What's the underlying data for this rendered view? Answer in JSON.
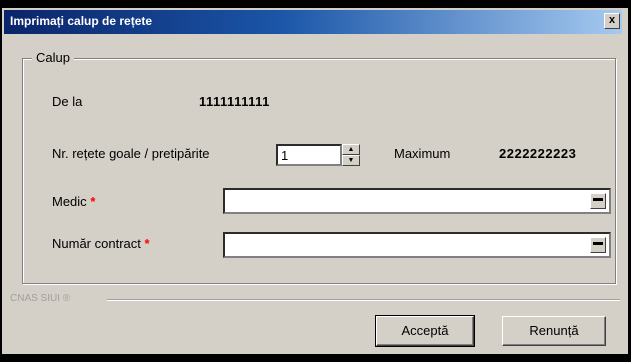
{
  "window": {
    "title": "Imprimați calup de rețete",
    "close_glyph": "x"
  },
  "group": {
    "title": "Calup"
  },
  "fields": {
    "from_label": "De la",
    "from_value": "1111111111",
    "count_label": "Nr. rețete goale / pretipărite",
    "count_value": "1",
    "max_label": "Maximum",
    "max_value": "2222222223",
    "medic_label": "Medic",
    "contract_label": "Număr contract",
    "required_mark": "*"
  },
  "footer": {
    "brand": "CNAS SIUI ®"
  },
  "buttons": {
    "accept": "Acceptă",
    "cancel": "Renunță"
  },
  "colors": {
    "title_start": "#0a246a",
    "title_end": "#a6caf0",
    "dialog_bg": "#d4d0c8",
    "required": "#ff0000"
  }
}
